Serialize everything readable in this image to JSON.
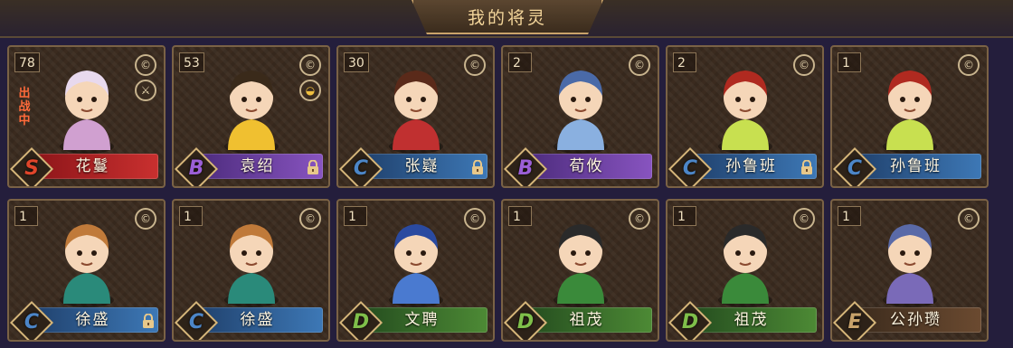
{
  "header": {
    "title": "我的将灵"
  },
  "grade_colors": {
    "S": "#e0452a",
    "B": "#9b5fd6",
    "C": "#4c86c8",
    "D": "#7fbf4a",
    "E": "#c8a26a"
  },
  "icons": {
    "top": "coin-icon",
    "weapon": "sword-icon",
    "ingot": "ingot-icon",
    "lock": "lock-icon"
  },
  "cards": [
    {
      "count": "78",
      "name": "花鬘",
      "grade": "S",
      "status": "出战中",
      "side_icon": "sword-icon",
      "locked": false
    },
    {
      "count": "53",
      "name": "袁绍",
      "grade": "B",
      "status": "",
      "side_icon": "ingot-icon",
      "locked": true
    },
    {
      "count": "30",
      "name": "张嶷",
      "grade": "C",
      "status": "",
      "side_icon": "",
      "locked": true
    },
    {
      "count": "2",
      "name": "荀攸",
      "grade": "B",
      "status": "",
      "side_icon": "",
      "locked": false
    },
    {
      "count": "2",
      "name": "孙鲁班",
      "grade": "C",
      "status": "",
      "side_icon": "",
      "locked": true
    },
    {
      "count": "1",
      "name": "孙鲁班",
      "grade": "C",
      "status": "",
      "side_icon": "",
      "locked": false
    },
    {
      "count": "1",
      "name": "徐盛",
      "grade": "C",
      "status": "",
      "side_icon": "",
      "locked": true
    },
    {
      "count": "1",
      "name": "徐盛",
      "grade": "C",
      "status": "",
      "side_icon": "",
      "locked": false
    },
    {
      "count": "1",
      "name": "文聘",
      "grade": "D",
      "status": "",
      "side_icon": "",
      "locked": false
    },
    {
      "count": "1",
      "name": "祖茂",
      "grade": "D",
      "status": "",
      "side_icon": "",
      "locked": false
    },
    {
      "count": "1",
      "name": "祖茂",
      "grade": "D",
      "status": "",
      "side_icon": "",
      "locked": false
    },
    {
      "count": "1",
      "name": "公孙瓒",
      "grade": "E",
      "status": "",
      "side_icon": "",
      "locked": false
    }
  ]
}
